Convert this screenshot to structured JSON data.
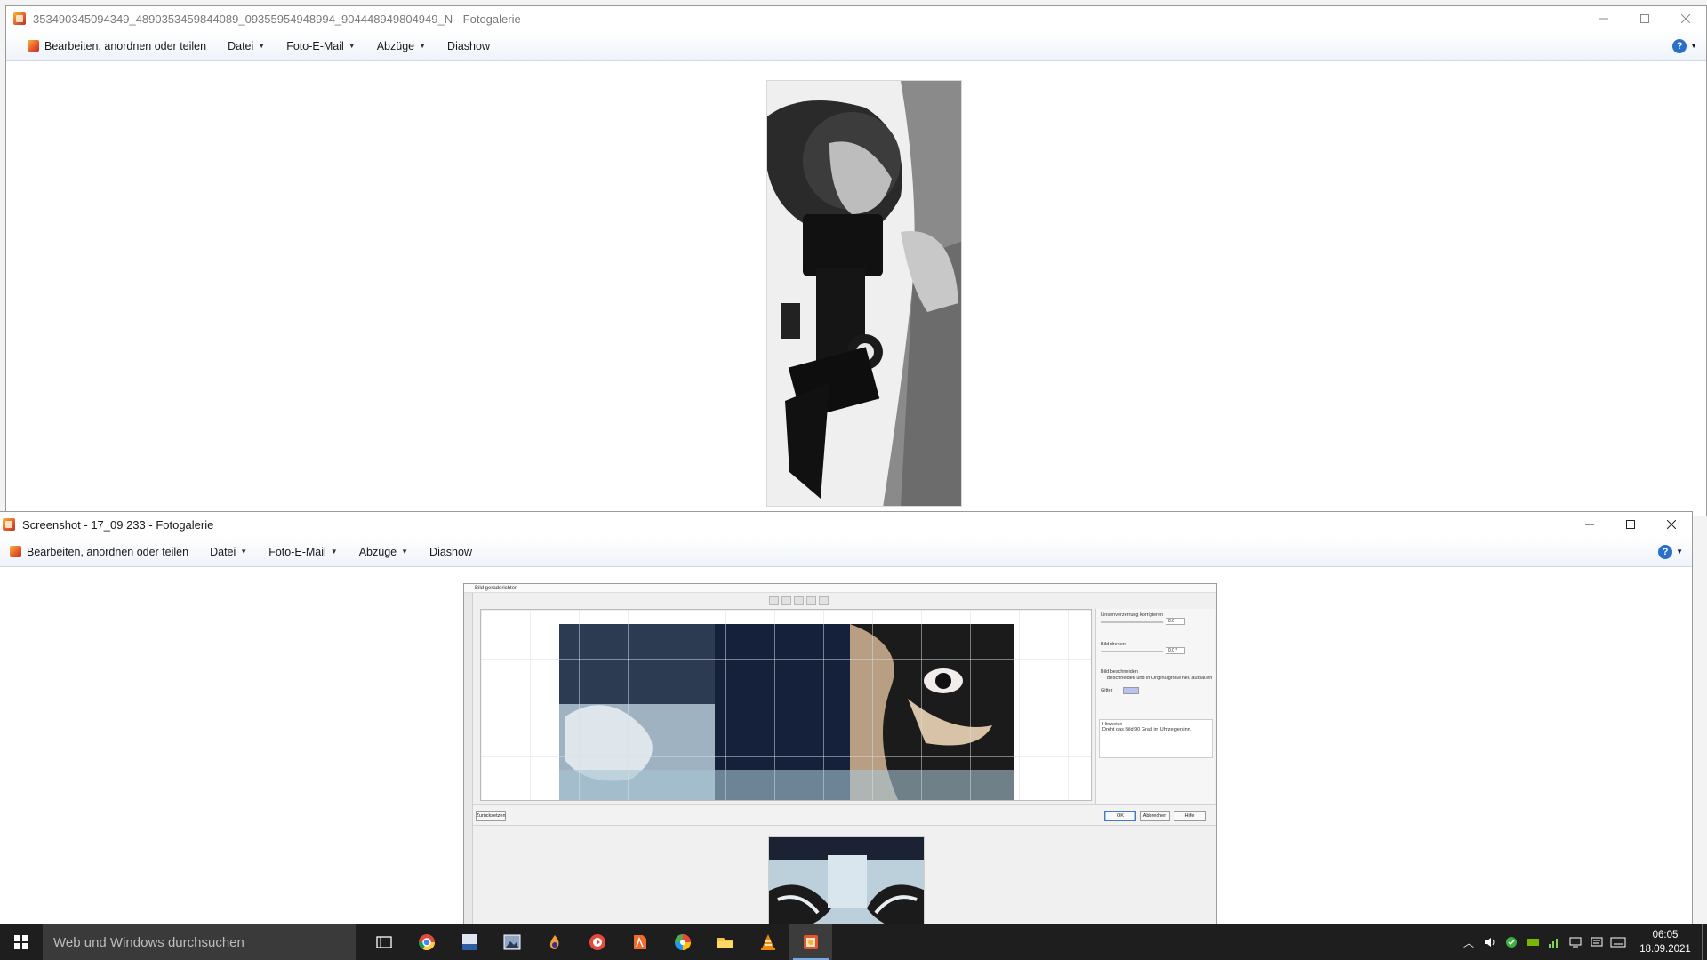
{
  "window_back": {
    "title": "353490345094349_4890353459844089_09355954948994_904448949804949_N - Fotogalerie",
    "menu": {
      "organize": "Bearbeiten, anordnen oder teilen",
      "file": "Datei",
      "email": "Foto-E-Mail",
      "prints": "Abzüge",
      "slideshow": "Diashow"
    }
  },
  "window_front": {
    "title": "Screenshot - 17_09 233 - Fotogalerie",
    "menu": {
      "organize": "Bearbeiten, anordnen oder teilen",
      "file": "Datei",
      "email": "Foto-E-Mail",
      "prints": "Abzüge",
      "slideshow": "Diashow"
    },
    "editor": {
      "title": "Bild geraderichten",
      "panel": {
        "perspective": "Linsenverzerrung korrigieren",
        "perspective_value": "0.0",
        "rotate": "Bild drehen",
        "rotate_value": "0.0 °",
        "crop": "Bild beschneiden",
        "crop_restore": "Beschneiden und in Originalgröße neu aufbauen",
        "grid": "Gitter",
        "hint_title": "Hinweise",
        "hint_text": "Dreht das Bild 90 Grad im Uhrzeigersinn."
      },
      "buttons": {
        "reset": "Zurücksetzen",
        "ok": "OK",
        "cancel": "Abbrechen",
        "help": "Hilfe"
      }
    }
  },
  "taskbar": {
    "search_placeholder": "Web und Windows durchsuchen",
    "time": "06:05",
    "date": "18.09.2021"
  }
}
